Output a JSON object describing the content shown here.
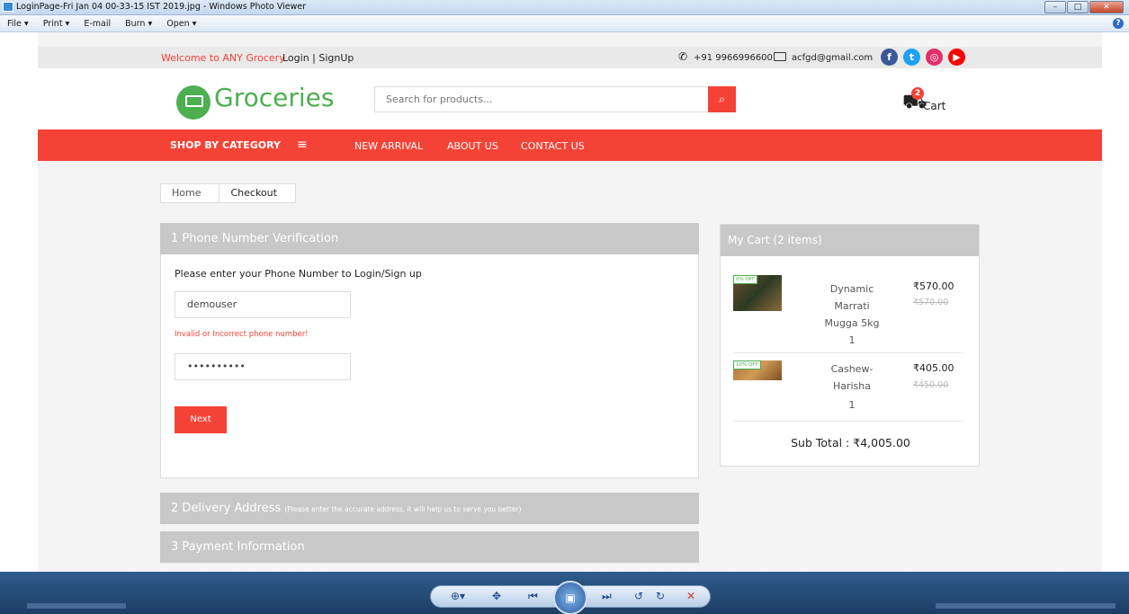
{
  "window": {
    "title": "LoginPage-Fri Jan 04 00-33-15 IST 2019.jpg - Windows Photo Viewer",
    "controls": [
      "–",
      "□",
      "✕"
    ]
  },
  "menu": [
    "File ▾",
    "Print ▾",
    "E-mail",
    "Burn ▾",
    "Open ▾"
  ],
  "site": {
    "welcome": "Welcome to ANY Grocery",
    "login": "Login | SignUp",
    "phone": "+91 9966996600",
    "email": "acfgd@gmail.com",
    "social_icons": [
      "facebook-icon",
      "twitter-icon",
      "instagram-icon",
      "youtube-icon"
    ],
    "brand": "Groceries",
    "search_placeholder": "Search for products...",
    "cart_count": "2",
    "cart_label": "Cart",
    "accent_color": "#f44336",
    "brand_color": "#4caf50"
  },
  "nav": {
    "category": "SHOP BY CATEGORY",
    "links": [
      "NEW ARRIVAL",
      "ABOUT US",
      "CONTACT US"
    ]
  },
  "breadcrumb": [
    "Home",
    "Checkout"
  ],
  "checkout": {
    "step1": "1  Phone Number Verification",
    "prompt": "Please enter your Phone Number to Login/Sign up",
    "username_value": "demouser",
    "error": "Invalid or Incorrect phone number!",
    "password_value": "••••••••••",
    "next": "Next",
    "step2": "2  Delivery Address",
    "step2_note": "(Please enter the accurate address, it will help us to serve you better)",
    "step3": "3  Payment Information"
  },
  "cart": {
    "title": "My Cart (2 items)",
    "items": [
      {
        "badge": "0% OFF",
        "name": "Dynamic Marrati Mugga 5kg",
        "qty": "1",
        "price": "₹570.00",
        "mrp": "₹570.00"
      },
      {
        "badge": "10% OFF",
        "name": "Cashew-Harisha",
        "qty": "1",
        "price": "₹405.00",
        "mrp": "₹450.00"
      }
    ],
    "subtotal": "Sub Total : ₹4,005.00"
  }
}
